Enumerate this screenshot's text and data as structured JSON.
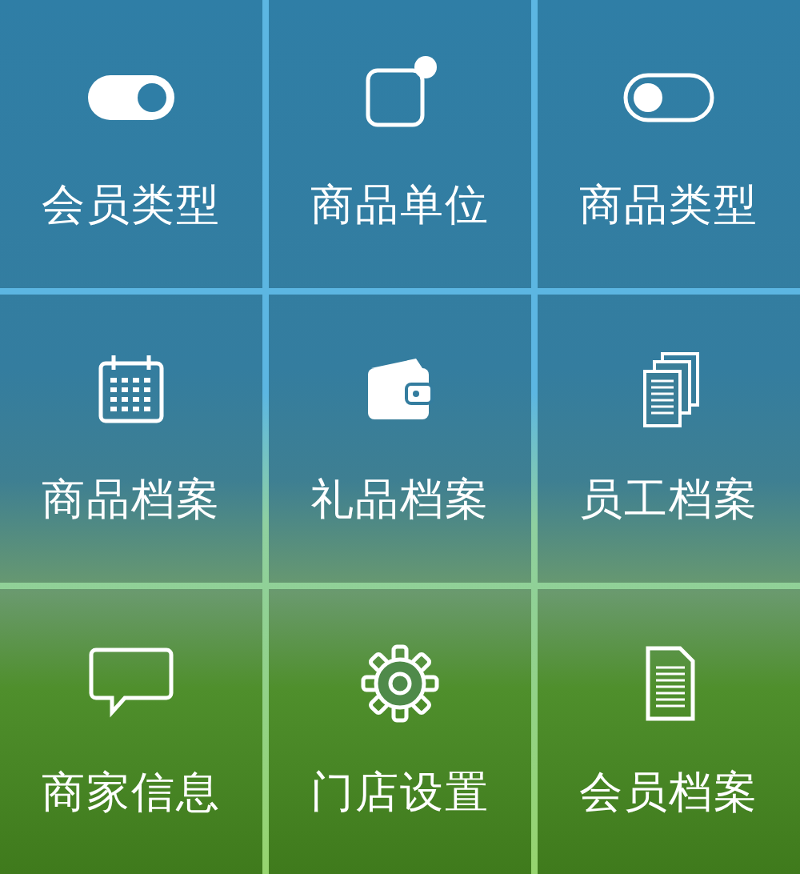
{
  "tiles": [
    {
      "label": "会员类型",
      "kind": "toggle",
      "on": true
    },
    {
      "label": "商品单位",
      "kind": "badge"
    },
    {
      "label": "商品类型",
      "kind": "toggle",
      "on": false
    },
    {
      "label": "商品档案",
      "kind": "calendar"
    },
    {
      "label": "礼品档案",
      "kind": "wallet"
    },
    {
      "label": "员工档案",
      "kind": "documents"
    },
    {
      "label": "商家信息",
      "kind": "chat"
    },
    {
      "label": "门店设置",
      "kind": "gear"
    },
    {
      "label": "会员档案",
      "kind": "document"
    }
  ]
}
